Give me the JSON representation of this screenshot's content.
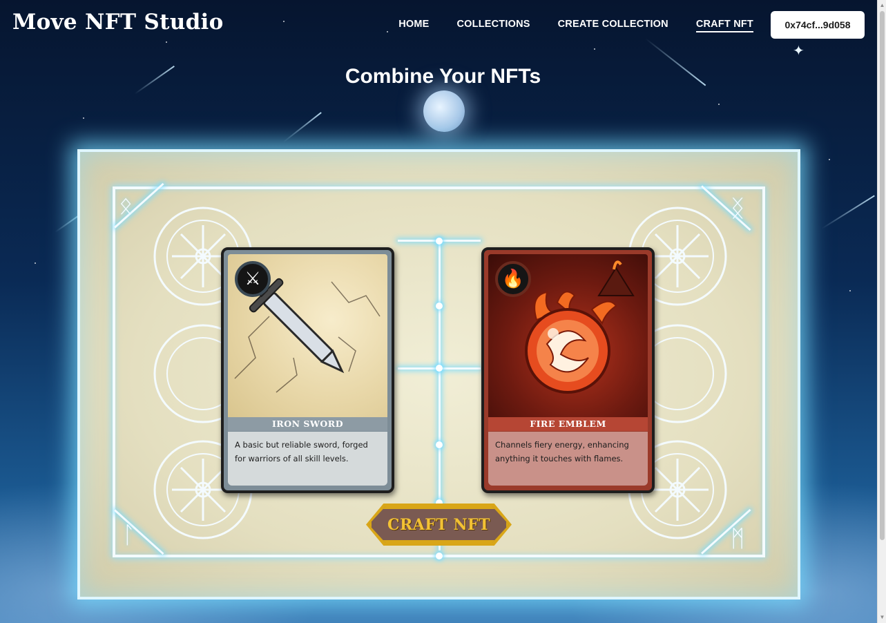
{
  "app": {
    "logo": "Move NFT Studio"
  },
  "nav": {
    "items": [
      {
        "label": "HOME",
        "active": false
      },
      {
        "label": "COLLECTIONS",
        "active": false
      },
      {
        "label": "CREATE COLLECTION",
        "active": false
      },
      {
        "label": "CRAFT NFT",
        "active": true
      }
    ],
    "wallet_address": "0x74cf...9d058"
  },
  "page": {
    "title": "Combine Your NFTs"
  },
  "cards": [
    {
      "name": "IRON SWORD",
      "description": "A basic but reliable sword, forged for warriors of all skill levels.",
      "icon": "crossed-swords-icon"
    },
    {
      "name": "FIRE EMBLEM",
      "description": "Channels fiery energy, enhancing anything it touches with flames.",
      "icon": "flame-icon"
    }
  ],
  "craft_button": {
    "label": "CRAFT NFT"
  },
  "colors": {
    "accent_gold": "#d9a618",
    "button_fill": "#7a5a52",
    "board_glow": "#78dcff"
  }
}
